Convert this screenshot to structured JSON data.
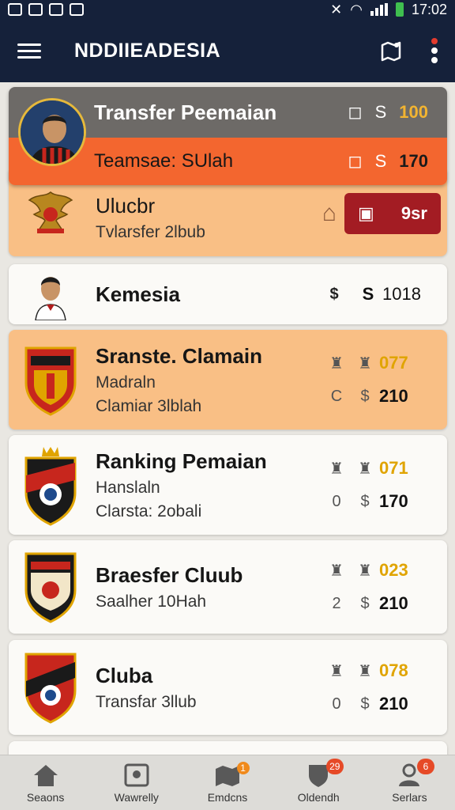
{
  "status_bar": {
    "time": "17:02"
  },
  "app_bar": {
    "title": "NDDIIEADESIA"
  },
  "featured": {
    "title": "Transfer Peemaian",
    "subtitle": "Teamsae: SUlah",
    "row1_icon2": "S",
    "row1_value": "100",
    "row2_icon2": "S",
    "row2_value": "170"
  },
  "club_card": {
    "title": "Ulucbr",
    "subtitle": "Tvlarsfer 2lbub",
    "button_value": "9sr"
  },
  "player_card": {
    "title": "Kemesia",
    "icon1": "$",
    "icon2": "S",
    "value": "1018"
  },
  "cards": [
    {
      "title": "Sranste. Clamain",
      "line1": "Madraln",
      "line2": "Clamiar 3lblah",
      "gold_value": "077",
      "r2_icon1": "C",
      "value": "210",
      "highlight": true
    },
    {
      "title": "Ranking Pemaian",
      "line1": "Hanslaln",
      "line2": "Clarsta: 2obali",
      "gold_value": "071",
      "r2_icon1": "0",
      "value": "170",
      "highlight": false
    },
    {
      "title": "Braesfer Cluub",
      "line1": "Saalher 10Hah",
      "line2": "",
      "gold_value": "023",
      "r2_icon1": "2",
      "value": "210",
      "highlight": false
    },
    {
      "title": "Cluba",
      "line1": "Transfar 3llub",
      "line2": "",
      "gold_value": "078",
      "r2_icon1": "0",
      "value": "210",
      "highlight": false
    }
  ],
  "bottom_nav": [
    {
      "label": "Seaons",
      "icon": "home-icon",
      "badge": ""
    },
    {
      "label": "Wawrelly",
      "icon": "photo-icon",
      "badge": ""
    },
    {
      "label": "Emdcns",
      "icon": "map-icon",
      "badge": "1"
    },
    {
      "label": "Oldendh",
      "icon": "shield-icon",
      "badge": "29"
    },
    {
      "label": "Serlars",
      "icon": "profile-icon",
      "badge": "6"
    }
  ],
  "colors": {
    "appbar": "#15213a",
    "accent_orange": "#f3662f",
    "card_orange": "#f9bf85",
    "gold": "#e0a400",
    "button_red": "#a31c23"
  }
}
